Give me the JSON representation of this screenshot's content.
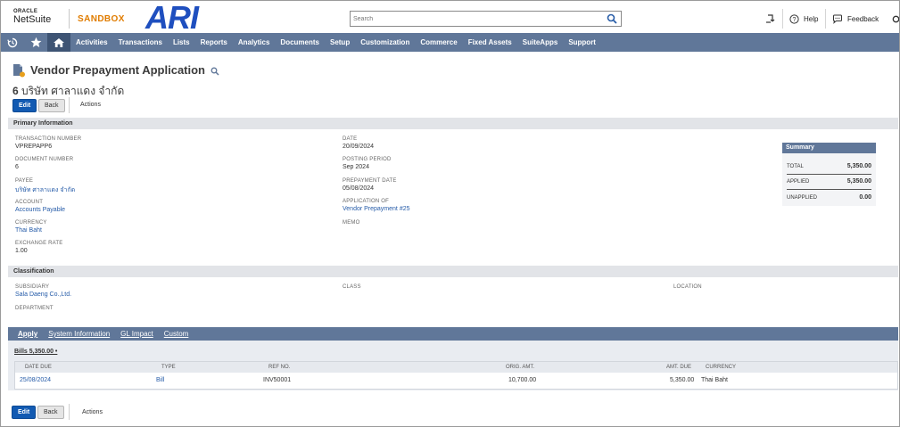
{
  "header": {
    "oracle": "ORACLE",
    "netsuite": "NetSuite",
    "sandbox": "SANDBOX",
    "logo": "ARI",
    "search_placeholder": "Search",
    "help": "Help",
    "feedback": "Feedback"
  },
  "nav": {
    "items": [
      "Activities",
      "Transactions",
      "Lists",
      "Reports",
      "Analytics",
      "Documents",
      "Setup",
      "Customization",
      "Commerce",
      "Fixed Assets",
      "SuiteApps",
      "Support"
    ]
  },
  "page": {
    "title": "Vendor Prepayment Application",
    "record_number": "6",
    "record_name": "บริษัท ศาลาแดง จำกัด",
    "edit_label": "Edit",
    "back_label": "Back",
    "actions_label": "Actions"
  },
  "primary": {
    "section_title": "Primary Information",
    "transaction_number_label": "TRANSACTION NUMBER",
    "transaction_number": "VPREPAPP6",
    "document_number_label": "DOCUMENT NUMBER",
    "document_number": "6",
    "payee_label": "PAYEE",
    "payee": "บริษัท ศาลาแดง จำกัด",
    "account_label": "ACCOUNT",
    "account": "Accounts Payable",
    "currency_label": "CURRENCY",
    "currency": "Thai Baht",
    "exchange_rate_label": "EXCHANGE RATE",
    "exchange_rate": "1.00",
    "date_label": "DATE",
    "date": "20/09/2024",
    "posting_period_label": "POSTING PERIOD",
    "posting_period": "Sep 2024",
    "prepayment_date_label": "PREPAYMENT DATE",
    "prepayment_date": "05/08/2024",
    "application_of_label": "APPLICATION OF",
    "application_of": "Vendor Prepayment #25",
    "memo_label": "MEMO"
  },
  "summary": {
    "title": "Summary",
    "total_label": "TOTAL",
    "total": "5,350.00",
    "applied_label": "APPLIED",
    "applied": "5,350.00",
    "unapplied_label": "UNAPPLIED",
    "unapplied": "0.00"
  },
  "classification": {
    "section_title": "Classification",
    "subsidiary_label": "SUBSIDIARY",
    "subsidiary": "Sala Daeng Co.,Ltd.",
    "department_label": "DEPARTMENT",
    "class_label": "CLASS",
    "location_label": "LOCATION"
  },
  "tabs": [
    "Apply",
    "System Information",
    "GL Impact",
    "Custom"
  ],
  "bills": {
    "title": "Bills 5,350.00 •",
    "columns": [
      "DATE DUE",
      "TYPE",
      "REF NO.",
      "ORIG. AMT.",
      "AMT. DUE",
      "CURRENCY"
    ],
    "rows": [
      {
        "date_due": "25/08/2024",
        "type": "Bill",
        "ref_no": "INV50001",
        "orig_amt": "10,700.00",
        "amt_due": "5,350.00",
        "currency": "Thai Baht"
      }
    ]
  }
}
